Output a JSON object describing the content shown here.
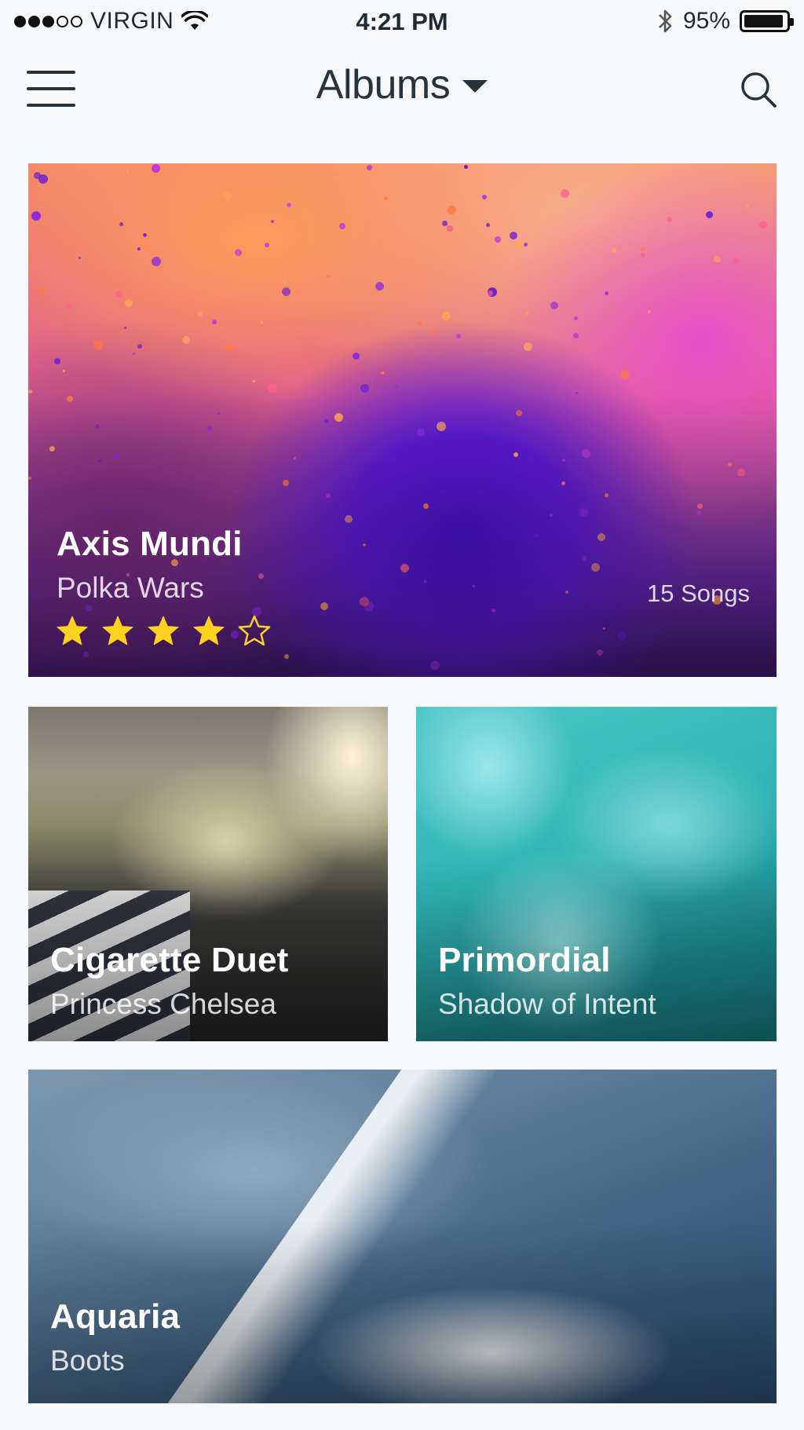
{
  "status_bar": {
    "carrier": "VIRGIN",
    "time": "4:21 PM",
    "battery": "95%",
    "battery_level": 0.95,
    "signal_bars": 3,
    "signal_total": 5,
    "icons": [
      "wifi-icon",
      "bluetooth-icon",
      "battery-icon"
    ]
  },
  "nav": {
    "title": "Albums",
    "icons": [
      "menu-icon",
      "chevron-down-icon",
      "search-icon"
    ]
  },
  "albums": [
    {
      "title": "Axis Mundi",
      "artist": "Polka Wars",
      "songs": "15 Songs",
      "rating": 4,
      "rating_max": 5
    },
    {
      "title": "Cigarette Duet",
      "artist": "Princess Chelsea"
    },
    {
      "title": "Primordial",
      "artist": "Shadow of Intent"
    },
    {
      "title": "Aquaria",
      "artist": "Boots"
    }
  ],
  "colors": {
    "background": "#f7f8fa",
    "text_dark": "#27333c",
    "star_gold": "#ffd21f"
  }
}
